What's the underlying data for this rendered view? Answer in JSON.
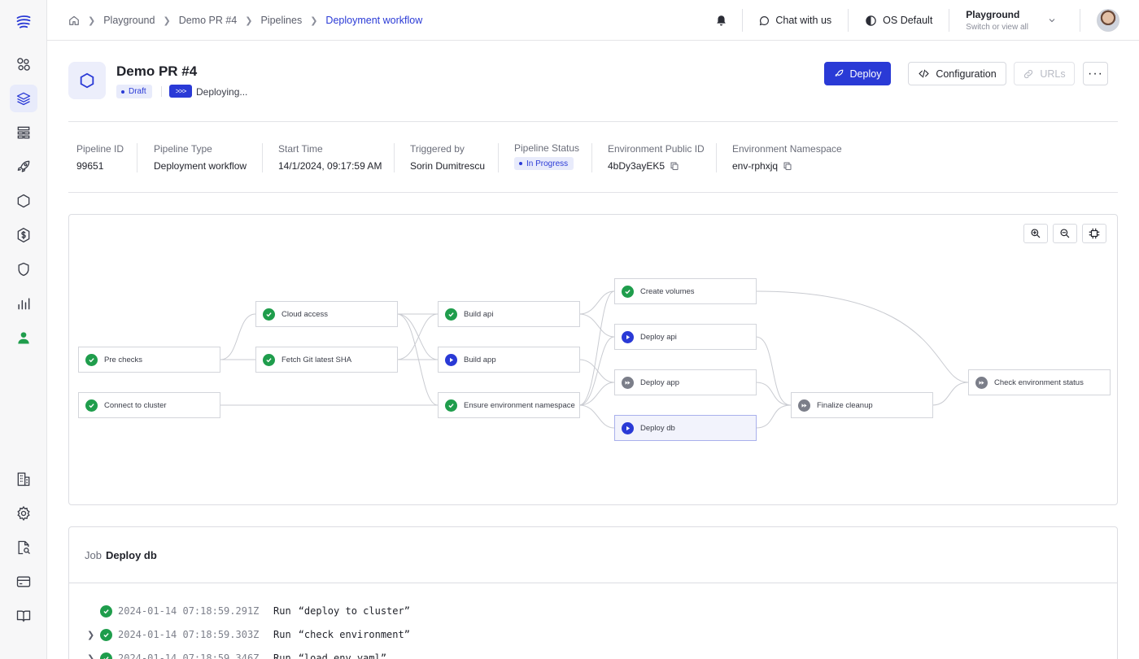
{
  "sidebar": {
    "items": [
      {
        "icon": "logo-icon"
      },
      {
        "icon": "graph-icon"
      },
      {
        "icon": "layers-icon",
        "active": true
      },
      {
        "icon": "table-icon"
      },
      {
        "icon": "rocket-icon"
      },
      {
        "icon": "hexagon-icon"
      },
      {
        "icon": "cost-icon"
      },
      {
        "icon": "shield-icon"
      },
      {
        "icon": "bar-chart-icon"
      },
      {
        "icon": "users-icon"
      },
      {
        "icon": "building-icon"
      },
      {
        "icon": "gear-icon"
      },
      {
        "icon": "search-doc-icon"
      },
      {
        "icon": "credit-card-icon"
      },
      {
        "icon": "book-icon"
      }
    ]
  },
  "breadcrumb": [
    "Playground",
    "Demo PR #4",
    "Pipelines",
    "Deployment workflow"
  ],
  "topbar": {
    "chat": "Chat with us",
    "theme": "OS Default",
    "org_name": "Playground",
    "org_sub": "Switch or view all"
  },
  "header": {
    "title": "Demo PR #4",
    "draft": "Draft",
    "deploying_icon": ">>>",
    "deploying": "Deploying...",
    "buttons": {
      "deploy": "Deploy",
      "configuration": "Configuration",
      "urls": "URLs",
      "more": "···"
    }
  },
  "info": {
    "pipeline_id": {
      "label": "Pipeline ID",
      "value": "99651"
    },
    "pipeline_type": {
      "label": "Pipeline Type",
      "value": "Deployment workflow"
    },
    "start_time": {
      "label": "Start Time",
      "value": "14/1/2024, 09:17:59 AM"
    },
    "triggered_by": {
      "label": "Triggered by",
      "value": "Sorin Dumitrescu"
    },
    "pipeline_status": {
      "label": "Pipeline Status",
      "value": "In Progress"
    },
    "env_public_id": {
      "label": "Environment Public ID",
      "value": "4bDy3ayEK5"
    },
    "env_namespace": {
      "label": "Environment Namespace",
      "value": "env-rphxjq"
    }
  },
  "pipeline": {
    "nodes": [
      {
        "id": "pre",
        "label": "Pre checks",
        "status": "success"
      },
      {
        "id": "connect",
        "label": "Connect to cluster",
        "status": "success"
      },
      {
        "id": "cloud",
        "label": "Cloud access",
        "status": "success"
      },
      {
        "id": "fetch",
        "label": "Fetch Git latest SHA",
        "status": "success"
      },
      {
        "id": "buildapi",
        "label": "Build api",
        "status": "success"
      },
      {
        "id": "buildapp",
        "label": "Build app",
        "status": "running"
      },
      {
        "id": "ensure",
        "label": "Ensure environment namespace",
        "status": "success"
      },
      {
        "id": "volumes",
        "label": "Create volumes",
        "status": "success"
      },
      {
        "id": "deployapi",
        "label": "Deploy api",
        "status": "running"
      },
      {
        "id": "deployapp",
        "label": "Deploy app",
        "status": "queued"
      },
      {
        "id": "deploydb",
        "label": "Deploy db",
        "status": "running",
        "selected": true
      },
      {
        "id": "cleanup",
        "label": "Finalize cleanup",
        "status": "queued"
      },
      {
        "id": "check",
        "label": "Check environment status",
        "status": "queued"
      }
    ]
  },
  "job": {
    "prefix": "Job",
    "name": "Deploy db",
    "logs": [
      {
        "ts": "2024-01-14 07:18:59.291Z",
        "run": "Run",
        "msg": "“deploy to cluster”",
        "expandable": false
      },
      {
        "ts": "2024-01-14 07:18:59.303Z",
        "run": "Run",
        "msg": "“check environment”",
        "expandable": true
      },
      {
        "ts": "2024-01-14 07:18:59.346Z",
        "run": "Run",
        "msg": "“load env yaml”",
        "expandable": true
      }
    ]
  },
  "colors": {
    "accent": "#2a3ad6",
    "success": "#1f9d4c",
    "queued": "#7b7e89"
  }
}
